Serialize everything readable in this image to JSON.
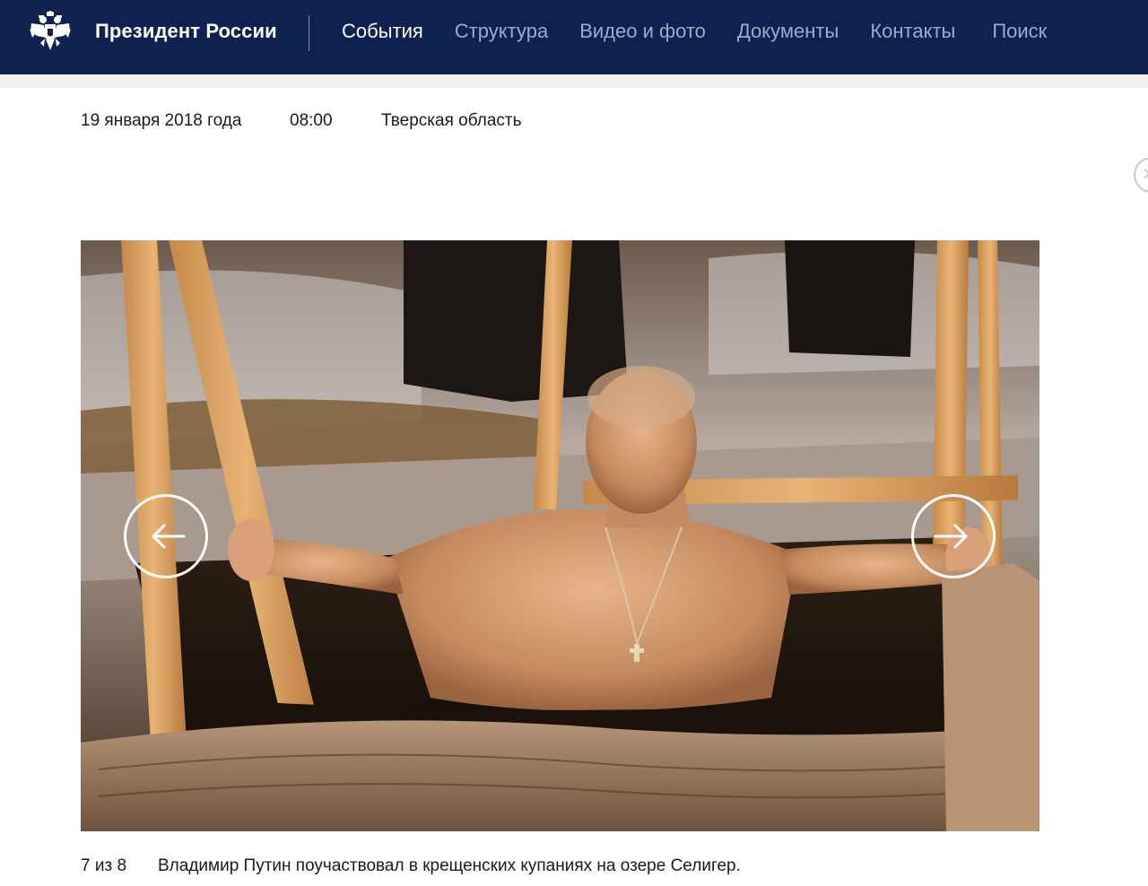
{
  "header": {
    "site_title": "Президент России",
    "nav": [
      {
        "label": "События",
        "active": true
      },
      {
        "label": "Структура",
        "active": false
      },
      {
        "label": "Видео и фото",
        "active": false
      },
      {
        "label": "Документы",
        "active": false
      },
      {
        "label": "Контакты",
        "active": false
      },
      {
        "label": "Поиск",
        "active": false
      }
    ],
    "icons": {
      "logo": "double-headed-eagle-emblem"
    }
  },
  "article": {
    "date": "19 января 2018 года",
    "time": "08:00",
    "place": "Тверская область"
  },
  "gallery": {
    "counter": "7 из 8",
    "caption": "Владимир Путин поучаствовал в крещенских купаниях на озере Селигер.",
    "prev_icon": "arrow-left-icon",
    "next_icon": "arrow-right-icon",
    "close_icon": "close-icon"
  },
  "colors": {
    "header_bg": "#0d2251",
    "nav_inactive": "#9fabc6",
    "nav_active": "#ffffff"
  }
}
